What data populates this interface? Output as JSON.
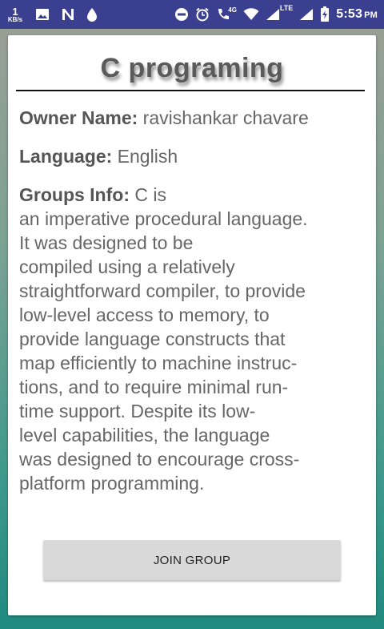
{
  "status_bar": {
    "speed_value": "1",
    "speed_unit": "KB/s",
    "network_4g": "4G",
    "network_lte": "LTE",
    "time": "5:53",
    "ampm": "PM"
  },
  "group": {
    "title": "C programing",
    "owner_label": "Owner Name:",
    "owner_value": " ravishankar chavare",
    "language_label": "Language:",
    "language_value": " English",
    "info_label": "Groups Info:",
    "info_first": " C is",
    "info_body": "an imperative procedural language.\nIt was designed to be\ncompiled using a relatively\nstraightforward compiler, to provide\nlow-level access to memory, to\nprovide language constructs that\nmap efficiently to machine instruc-\ntions, and to require minimal run-\ntime support. Despite its low-\nlevel capabilities, the language\nwas designed to encourage cross-\nplatform programming."
  },
  "actions": {
    "join_label": "JOIN GROUP"
  }
}
